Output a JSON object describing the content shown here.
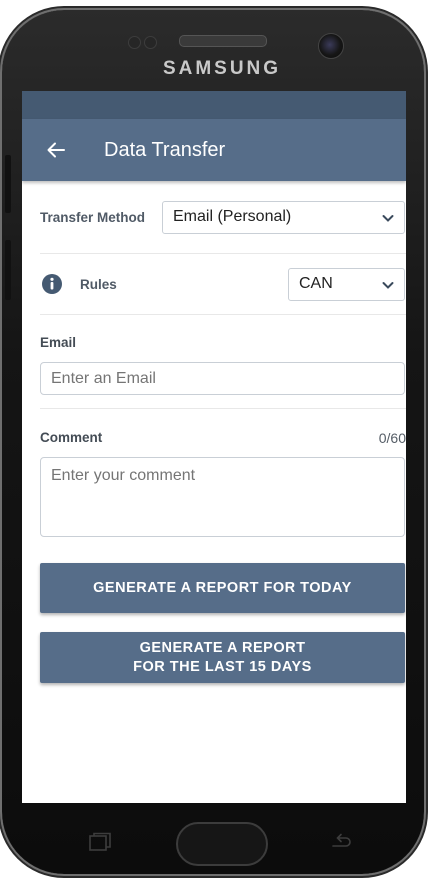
{
  "device": {
    "brand": "SAMSUNG"
  },
  "appbar": {
    "title": "Data Transfer",
    "back_icon": "arrow-left-icon"
  },
  "transfer_method": {
    "label": "Transfer Method",
    "value": "Email (Personal)"
  },
  "rules": {
    "label": "Rules",
    "value": "CAN",
    "icon": "info-icon"
  },
  "email": {
    "label": "Email",
    "placeholder": "Enter an Email"
  },
  "comment": {
    "label": "Comment",
    "counter": "0/60",
    "placeholder": "Enter your comment"
  },
  "buttons": {
    "report_today": "GENERATE A REPORT FOR TODAY",
    "report_15_line1": "GENERATE A REPORT",
    "report_15_line2": "FOR THE LAST 15 DAYS"
  },
  "colors": {
    "primary": "#566d89",
    "status_bar": "#455a72"
  }
}
